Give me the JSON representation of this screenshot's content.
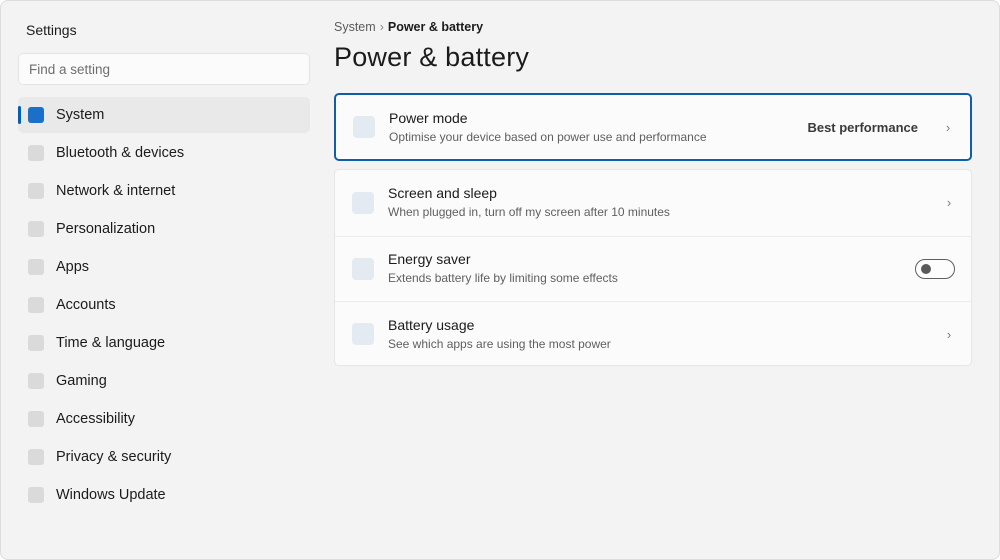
{
  "app": {
    "title": "Settings"
  },
  "search": {
    "placeholder": "Find a setting"
  },
  "sidebar": {
    "items": [
      {
        "label": "System",
        "selected": true
      },
      {
        "label": "Bluetooth & devices"
      },
      {
        "label": "Network & internet"
      },
      {
        "label": "Personalization"
      },
      {
        "label": "Apps"
      },
      {
        "label": "Accounts"
      },
      {
        "label": "Time & language"
      },
      {
        "label": "Gaming"
      },
      {
        "label": "Accessibility"
      },
      {
        "label": "Privacy & security"
      },
      {
        "label": "Windows Update"
      }
    ]
  },
  "breadcrumb": {
    "parent": "System",
    "separator": "›",
    "current": "Power & battery"
  },
  "page": {
    "title": "Power & battery"
  },
  "power_mode": {
    "title": "Power mode",
    "description": "Optimise your device based on power use and performance",
    "value": "Best performance",
    "chevron": "›"
  },
  "settings": [
    {
      "title": "Screen and sleep",
      "description": "When plugged in, turn off my screen after 10 minutes",
      "chevron": "›"
    },
    {
      "title": "Energy saver",
      "description": "Extends battery life by limiting some effects",
      "toggle_on": false
    },
    {
      "title": "Battery usage",
      "description": "See which apps are using the most power",
      "chevron": "›"
    }
  ],
  "colors": {
    "accent": "#005fb8",
    "focus_border": "#0f5ea8",
    "background": "#f3f3f3",
    "card": "#fbfbfb"
  }
}
